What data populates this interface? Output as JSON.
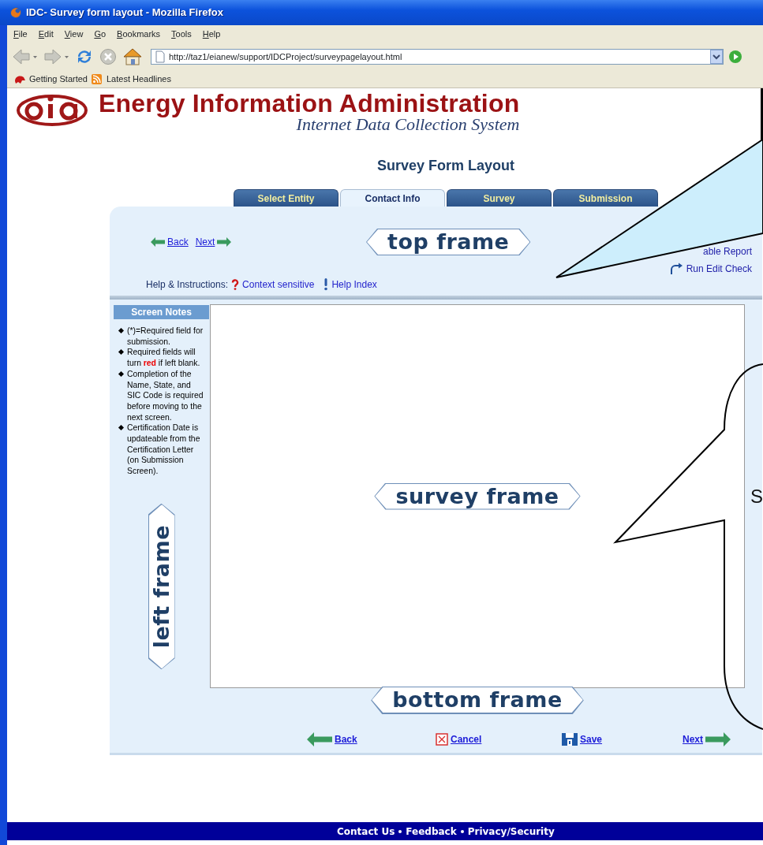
{
  "window": {
    "title": "IDC- Survey form layout - Mozilla Firefox"
  },
  "menu": [
    "File",
    "Edit",
    "View",
    "Go",
    "Bookmarks",
    "Tools",
    "Help"
  ],
  "address_bar": {
    "value": "http://taz1/eianew/support/IDCProject/surveypagelayout.html"
  },
  "bookmarks": [
    "Getting Started",
    "Latest Headlines"
  ],
  "header": {
    "title": "Energy Information Administration",
    "subtitle": "Internet Data Collection System"
  },
  "page_title": "Survey Form Layout",
  "tabs": [
    {
      "label": "Select Entity",
      "selected": false
    },
    {
      "label": "Contact Info",
      "selected": true
    },
    {
      "label": "Survey",
      "selected": false
    },
    {
      "label": "Submission",
      "selected": false
    }
  ],
  "top_frame": {
    "label": "top frame",
    "nav": [
      {
        "label": "Back",
        "kind": "back"
      },
      {
        "label": "Next",
        "kind": "next"
      }
    ],
    "actions": [
      {
        "label": "able Report",
        "kind": "report"
      },
      {
        "label": "Run Edit Check",
        "kind": "check"
      }
    ],
    "help_label": "Help & Instructions:",
    "help_links": [
      {
        "label": "Context sensitive",
        "kind": "question"
      },
      {
        "label": "Help Index",
        "kind": "exclaim"
      }
    ]
  },
  "left_frame": {
    "label": "left frame",
    "heading": "Screen Notes",
    "notes": [
      "(*)=Required field for submission.",
      "Required fields will turn **red** if left blank.",
      "Completion of the Name, State, and SIC Code is required before moving to the next screen.",
      "Certification Date is updateable from the Certification Letter (on Submission Screen)."
    ]
  },
  "survey_frame": {
    "label": "survey frame"
  },
  "bottom_frame": {
    "label": "bottom frame",
    "buttons": [
      {
        "label": "Back",
        "kind": "back"
      },
      {
        "label": "Cancel",
        "kind": "cancel"
      },
      {
        "label": "Save",
        "kind": "save"
      },
      {
        "label": "Next",
        "kind": "next"
      }
    ]
  },
  "callouts": [
    {
      "kind": "pointer"
    },
    {
      "kind": "cloud",
      "text": "S"
    }
  ],
  "footer": {
    "links": [
      "Contact Us",
      "Feedback",
      "Privacy/Security"
    ]
  }
}
